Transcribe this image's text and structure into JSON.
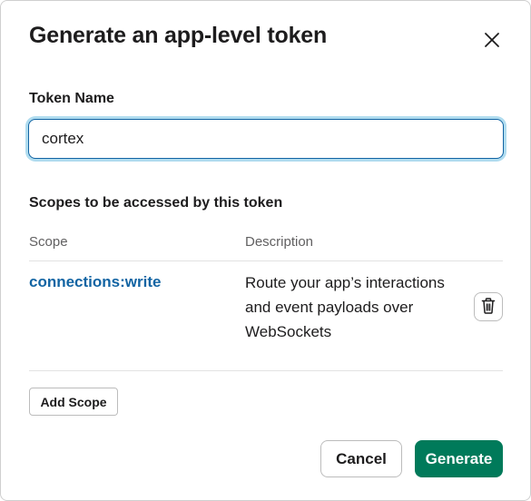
{
  "modal": {
    "title": "Generate an app-level token"
  },
  "token_name": {
    "label": "Token Name",
    "value": "cortex"
  },
  "scopes": {
    "heading": "Scopes to be accessed by this token",
    "columns": {
      "scope": "Scope",
      "description": "Description"
    },
    "rows": [
      {
        "scope": "connections:write",
        "description": "Route your app’s interactions and event payloads over WebSockets"
      }
    ],
    "add_label": "Add Scope"
  },
  "footer": {
    "cancel_label": "Cancel",
    "generate_label": "Generate"
  },
  "colors": {
    "link": "#1264a3",
    "primary": "#007a5a",
    "focus_border": "#1264a3"
  },
  "icons": {
    "close": "close-icon",
    "delete": "trash-icon"
  }
}
